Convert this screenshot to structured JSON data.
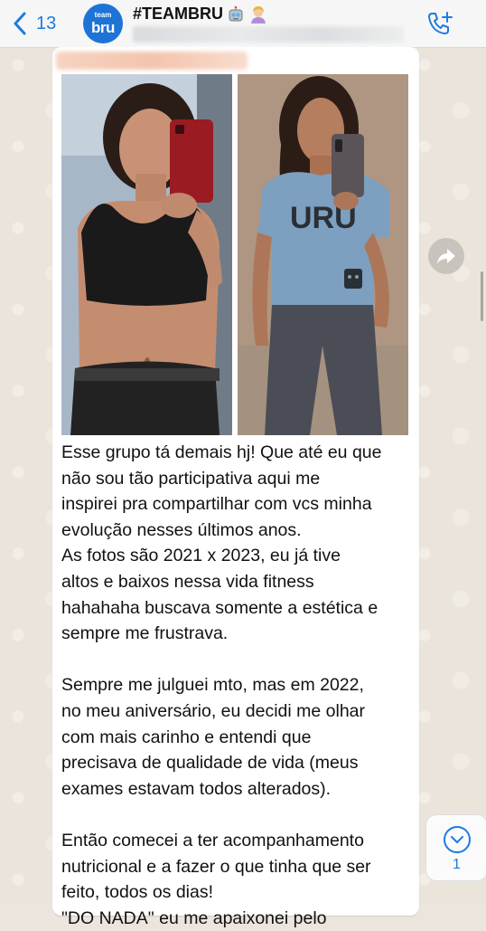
{
  "header": {
    "back_count": "13",
    "group_title": "#TEAMBRU",
    "avatar_small": "team",
    "avatar_big": "bru",
    "title_emojis": [
      "robot-face-emoji",
      "woman-tipping-hand-emoji"
    ]
  },
  "message": {
    "photo_left_alt": "selfie 2021",
    "photo_right_alt": "selfie 2023",
    "shirt_print": "URU",
    "paragraphs": [
      [
        "Esse grupo tá demais hj! Que até eu que",
        "não sou tão participativa aqui me",
        "inspirei pra compartilhar com vcs minha",
        "evolução nesses últimos anos.",
        "As fotos são 2021 x 2023, eu já tive",
        "altos e baixos nessa vida fitness",
        "hahahaha buscava somente a estética e",
        "sempre me frustrava."
      ],
      [
        "Sempre me julguei mto, mas em 2022,",
        "no meu aniversário, eu decidi me olhar",
        "com mais carinho e entendi que",
        "precisava de qualidade de vida (meus",
        "exames estavam todos alterados)."
      ],
      [
        "Então comecei a ter acompanhamento",
        "nutricional e a fazer o que tinha que ser",
        "feito, todos os dias!",
        "\"DO NADA\" eu me apaixonei pelo"
      ]
    ]
  },
  "scroll_down": {
    "unread_count": "1"
  },
  "colors": {
    "accent": "#1f7ae0",
    "avatar_bg": "#1d74d6",
    "bubble": "#ffffff",
    "wallpaper": "#ebe4da"
  }
}
